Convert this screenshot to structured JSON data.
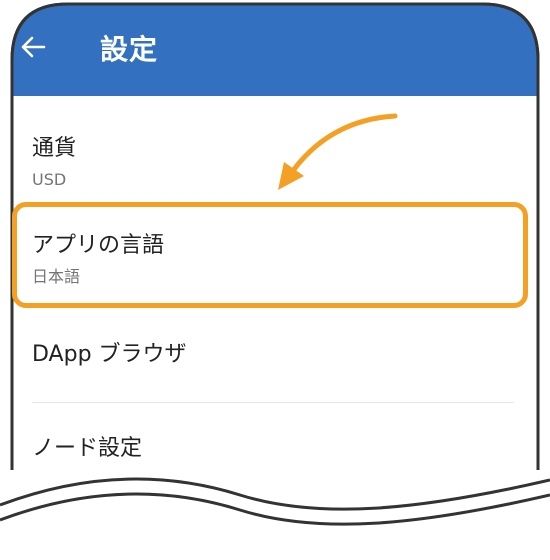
{
  "header": {
    "title": "設定",
    "back_icon": "arrow-left-icon",
    "background": "#3371c0"
  },
  "settings": [
    {
      "title": "通貨",
      "subtitle": "USD"
    },
    {
      "title": "アプリの言語",
      "subtitle": "日本語"
    },
    {
      "title": "DApp ブラウザ"
    },
    {
      "title": "ノード設定"
    }
  ],
  "annotation": {
    "highlight_color": "#f4a024"
  }
}
